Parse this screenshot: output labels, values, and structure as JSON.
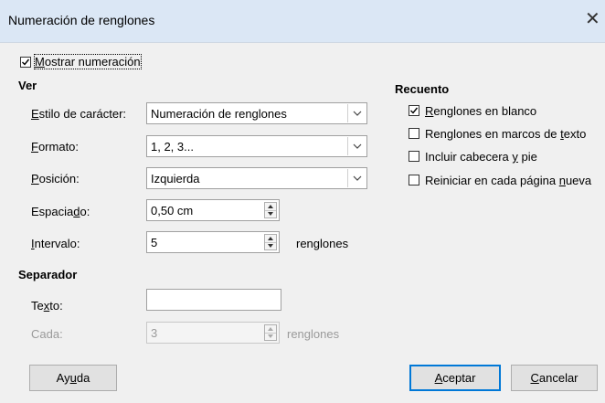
{
  "dialog": {
    "title": "Numeración de renglones",
    "close_glyph": "✕"
  },
  "show_numbering": {
    "label_pre": "",
    "label_key": "M",
    "label_post": "ostrar numeración",
    "checked": true
  },
  "view": {
    "heading": "Ver",
    "char_style": {
      "label_pre": "",
      "label_key": "E",
      "label_post": "stilo de carácter:",
      "value": "Numeración de renglones"
    },
    "format": {
      "label_pre": "",
      "label_key": "F",
      "label_post": "ormato:",
      "value": "1, 2, 3..."
    },
    "position": {
      "label_pre": "",
      "label_key": "P",
      "label_post": "osición:",
      "value": "Izquierda"
    },
    "spacing": {
      "label_pre": "Espacia",
      "label_key": "d",
      "label_post": "o:",
      "value": "0,50 cm"
    },
    "interval": {
      "label_pre": "",
      "label_key": "I",
      "label_post": "ntervalo:",
      "value": "5",
      "unit": "renglones"
    }
  },
  "separator": {
    "heading": "Separador",
    "text": {
      "label_pre": "Te",
      "label_key": "x",
      "label_post": "to:",
      "value": ""
    },
    "every": {
      "label": "Cada:",
      "value": "3",
      "unit": "renglones"
    }
  },
  "count": {
    "heading": "Recuento",
    "options": [
      {
        "label_pre": "",
        "label_key": "R",
        "label_post": "englones en blanco",
        "checked": true
      },
      {
        "label_pre": "Renglones en marcos de ",
        "label_key": "t",
        "label_post": "exto",
        "checked": false
      },
      {
        "label_pre": "Incluir cabecera ",
        "label_key": "y",
        "label_post": " pie",
        "checked": false
      },
      {
        "label_pre": "Reiniciar en cada página ",
        "label_key": "n",
        "label_post": "ueva",
        "checked": false
      }
    ]
  },
  "buttons": {
    "help": {
      "label_pre": "Ay",
      "label_key": "u",
      "label_post": "da"
    },
    "ok": {
      "label_pre": "",
      "label_key": "A",
      "label_post": "ceptar"
    },
    "cancel": {
      "label_pre": "",
      "label_key": "C",
      "label_post": "ancelar"
    }
  }
}
